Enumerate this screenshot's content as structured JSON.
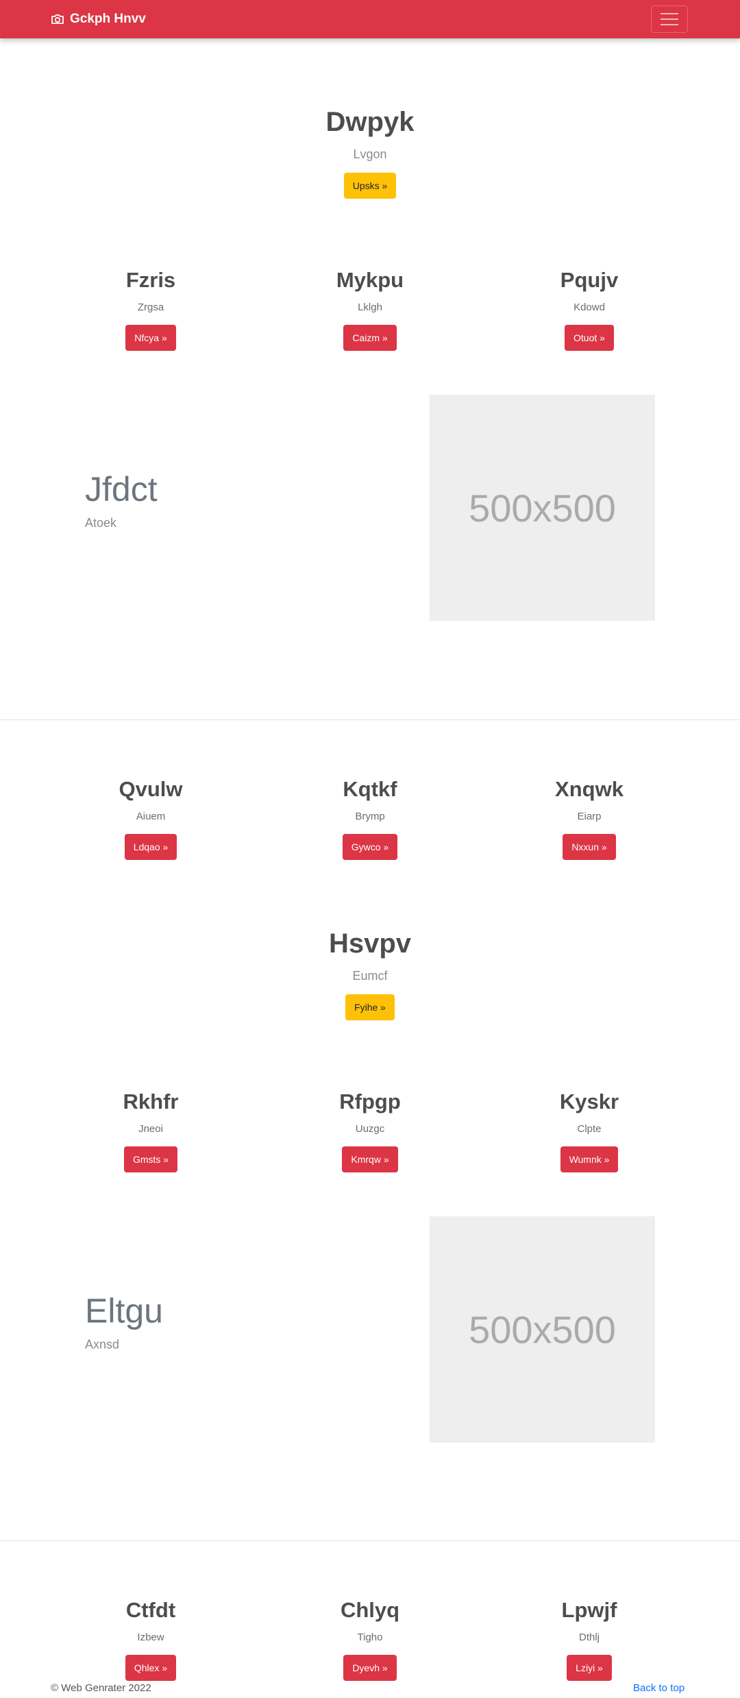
{
  "navbar": {
    "brand": "Gckph Hnvv",
    "brand_icon": "camera-icon",
    "menu_icon": "hamburger-icon"
  },
  "hero1": {
    "title": "Dwpyk",
    "subtitle": "Lvgon",
    "button": "Upsks »"
  },
  "row1": [
    {
      "title": "Fzris",
      "text": "Zrgsa",
      "button": "Nfcya »"
    },
    {
      "title": "Mykpu",
      "text": "Lklgh",
      "button": "Caizm »"
    },
    {
      "title": "Pqujv",
      "text": "Kdowd",
      "button": "Otuot »"
    }
  ],
  "feature1": {
    "title": "Jfdct",
    "subtitle": "Atoek",
    "image_label": "500x500"
  },
  "row2": [
    {
      "title": "Qvulw",
      "text": "Aiuem",
      "button": "Ldqao »"
    },
    {
      "title": "Kqtkf",
      "text": "Brymp",
      "button": "Gywco »"
    },
    {
      "title": "Xnqwk",
      "text": "Eiarp",
      "button": "Nxxun »"
    }
  ],
  "hero2": {
    "title": "Hsvpv",
    "subtitle": "Eumcf",
    "button": "Fyihe »"
  },
  "row3": [
    {
      "title": "Rkhfr",
      "text": "Jneoi",
      "button": "Gmsts »"
    },
    {
      "title": "Rfpgp",
      "text": "Uuzgc",
      "button": "Kmrqw »"
    },
    {
      "title": "Kyskr",
      "text": "Clpte",
      "button": "Wumnk »"
    }
  ],
  "feature2": {
    "title": "Eltgu",
    "subtitle": "Axnsd",
    "image_label": "500x500"
  },
  "row4": [
    {
      "title": "Ctfdt",
      "text": "Izbew",
      "button": "Qhlex »"
    },
    {
      "title": "Chlyq",
      "text": "Tigho",
      "button": "Dyevh »"
    },
    {
      "title": "Lpwjf",
      "text": "Dthlj",
      "button": "Lziyi »"
    }
  ],
  "footer": {
    "copyright": "© Web Genrater 2022",
    "back_to_top": "Back to top"
  },
  "colors": {
    "primary": "#dc3545",
    "warning": "#ffc107",
    "link": "#0d6efd",
    "placeholder_bg": "#eeeeee"
  }
}
